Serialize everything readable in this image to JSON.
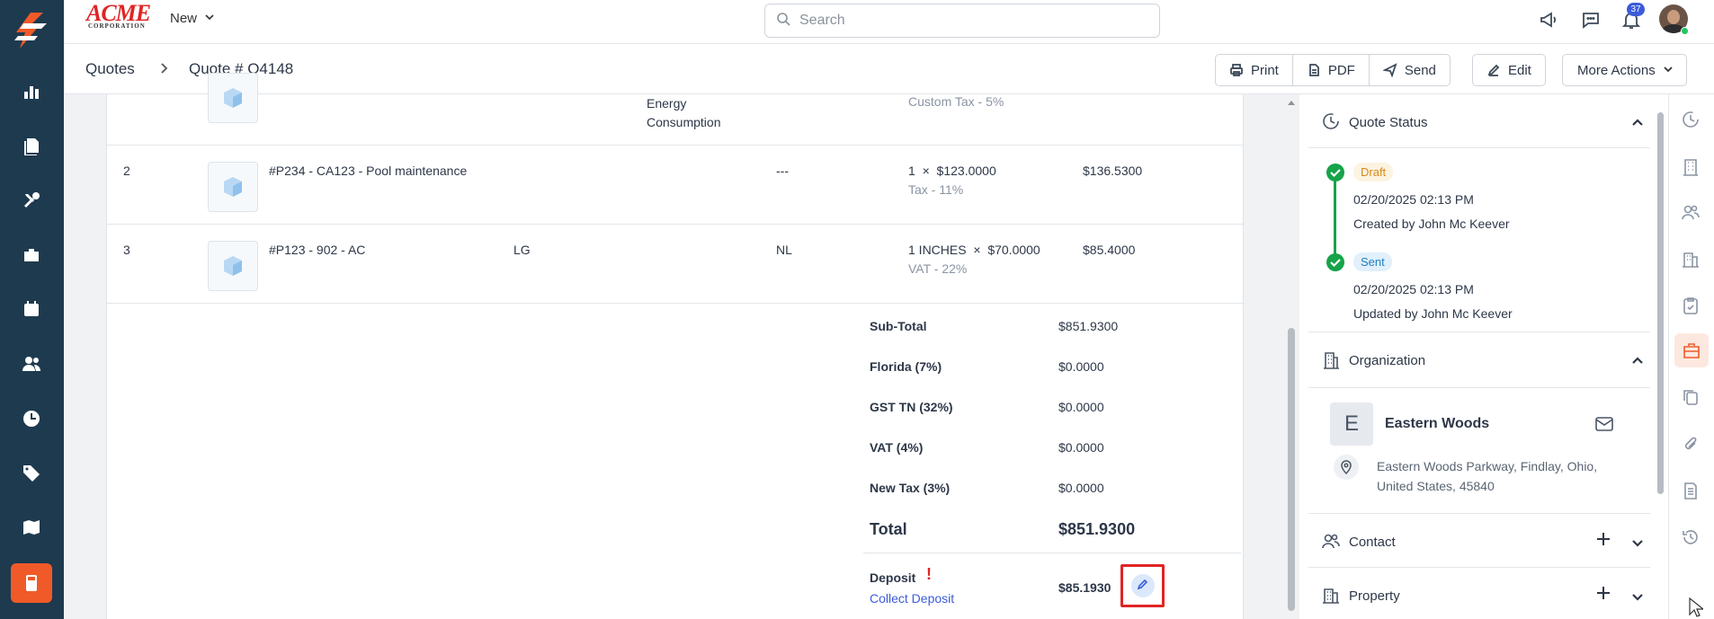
{
  "brand": {
    "name": "ACME",
    "sub": "CORPORATION"
  },
  "topbar": {
    "new_label": "New",
    "search_placeholder": "Search",
    "notification_count": "37"
  },
  "breadcrumb": {
    "parent": "Quotes",
    "current": "Quote # Q4148"
  },
  "actions": {
    "print": "Print",
    "pdf": "PDF",
    "send": "Send",
    "edit": "Edit",
    "more": "More Actions"
  },
  "line_items": {
    "partial_row": {
      "description": "Energy Consumption",
      "tax": "Custom Tax - 5%"
    },
    "rows": [
      {
        "num": "2",
        "item": "#P234 - CA123 - Pool maintenance",
        "brand": "",
        "location": "---",
        "qty": "1",
        "times": "×",
        "rate": "$123.0000",
        "tax": "Tax - 11%",
        "amount": "$136.5300"
      },
      {
        "num": "3",
        "item": "#P123 - 902 - AC",
        "brand": "LG",
        "location": "NL",
        "qty": "1 INCHES",
        "times": "×",
        "rate": "$70.0000",
        "tax": "VAT - 22%",
        "amount": "$85.4000"
      }
    ]
  },
  "summary": {
    "subtotal_label": "Sub-Total",
    "subtotal": "$851.9300",
    "taxes": [
      {
        "label": "Florida (7%)",
        "value": "$0.0000"
      },
      {
        "label": "GST TN (32%)",
        "value": "$0.0000"
      },
      {
        "label": "VAT (4%)",
        "value": "$0.0000"
      },
      {
        "label": "New Tax (3%)",
        "value": "$0.0000"
      }
    ],
    "total_label": "Total",
    "total": "$851.9300",
    "deposit_label": "Deposit",
    "deposit_alert": "!",
    "deposit": "$85.1930",
    "collect_label": "Collect Deposit"
  },
  "quote_status": {
    "title": "Quote Status",
    "events": [
      {
        "status": "Draft",
        "date": "02/20/2025 02:13 PM",
        "by": "Created by John Mc Keever"
      },
      {
        "status": "Sent",
        "date": "02/20/2025 02:13 PM",
        "by": "Updated by John Mc Keever"
      }
    ]
  },
  "organization": {
    "title": "Organization",
    "initial": "E",
    "name": "Eastern Woods",
    "address_line1": "Eastern Woods Parkway, Findlay, Ohio,",
    "address_line2": "United States, 45840"
  },
  "contact": {
    "title": "Contact"
  },
  "property": {
    "title": "Property"
  },
  "colors": {
    "sidebar": "#1e3a4f",
    "accent": "#f05a28",
    "link": "#3b5bdb",
    "success": "#16a34a",
    "danger": "#e02424"
  }
}
